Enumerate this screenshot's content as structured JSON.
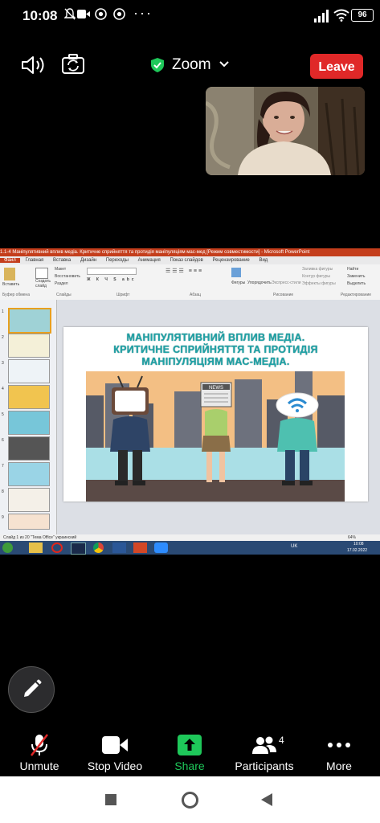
{
  "status_bar": {
    "time": "10:08",
    "icons": [
      "mute-icon",
      "video-icon",
      "chrome-icon",
      "chrome-icon"
    ],
    "more": "···",
    "battery": "96"
  },
  "meeting": {
    "title": "Zoom",
    "leave_label": "Leave",
    "accent": "#e02828"
  },
  "presentation": {
    "window_title": "1.1-4 Маніпулятивний вплив медіа. Критичне сприйняття та протидія маніпуляціям мас-мед [Режим совместимости] - Microsoft PowerPoint",
    "tabs": [
      "Файл",
      "Главная",
      "Вставка",
      "Дизайн",
      "Переходы",
      "Анимация",
      "Показ слайдов",
      "Рецензирование",
      "Вид"
    ],
    "ribbon_groups": [
      "Буфер обмена",
      "Слайды",
      "Шрифт",
      "Абзац",
      "Рисование",
      "Редактирование"
    ],
    "ribbon_items": {
      "paste": "Вставить",
      "new_slide": "Создать слайд",
      "layout": "Макет",
      "reset": "Восстановить",
      "section": "Раздел",
      "shapes": "Фигуры",
      "arrange": "Упорядочить",
      "quick_styles": "Экспресс-стили",
      "fill": "Заливка фигуры",
      "outline": "Контур фигуры",
      "effects": "Эффекты фигуры",
      "find": "Найти",
      "replace": "Заменить",
      "select": "Выделить"
    },
    "slide_heading_lines": [
      "МАНІПУЛЯТИВНИЙ ВПЛИВ МЕДІА.",
      "КРИТИЧНЕ СПРИЙНЯТТЯ ТА ПРОТИДІЯ",
      "МАНІПУЛЯЦІЯМ МАС-МЕДІА."
    ],
    "news_sign": "NEWS",
    "slide_numbers": [
      "1",
      "2",
      "3",
      "4",
      "5",
      "6",
      "7",
      "8",
      "9"
    ],
    "status_left": "Слайд 1 из 20   \"Тема Office\"   украинский",
    "zoom": "64%",
    "tray_lang": "UK",
    "tray_time": "10:08",
    "tray_date": "17.02.2022"
  },
  "toolbar": {
    "unmute": "Unmute",
    "stop_video": "Stop Video",
    "share": "Share",
    "participants": "Participants",
    "participants_count": "4",
    "more": "More"
  },
  "colors": {
    "share_green": "#1ec85a",
    "slide_title_teal": "#1fa2a6",
    "ppt_red": "#c43e1c"
  }
}
